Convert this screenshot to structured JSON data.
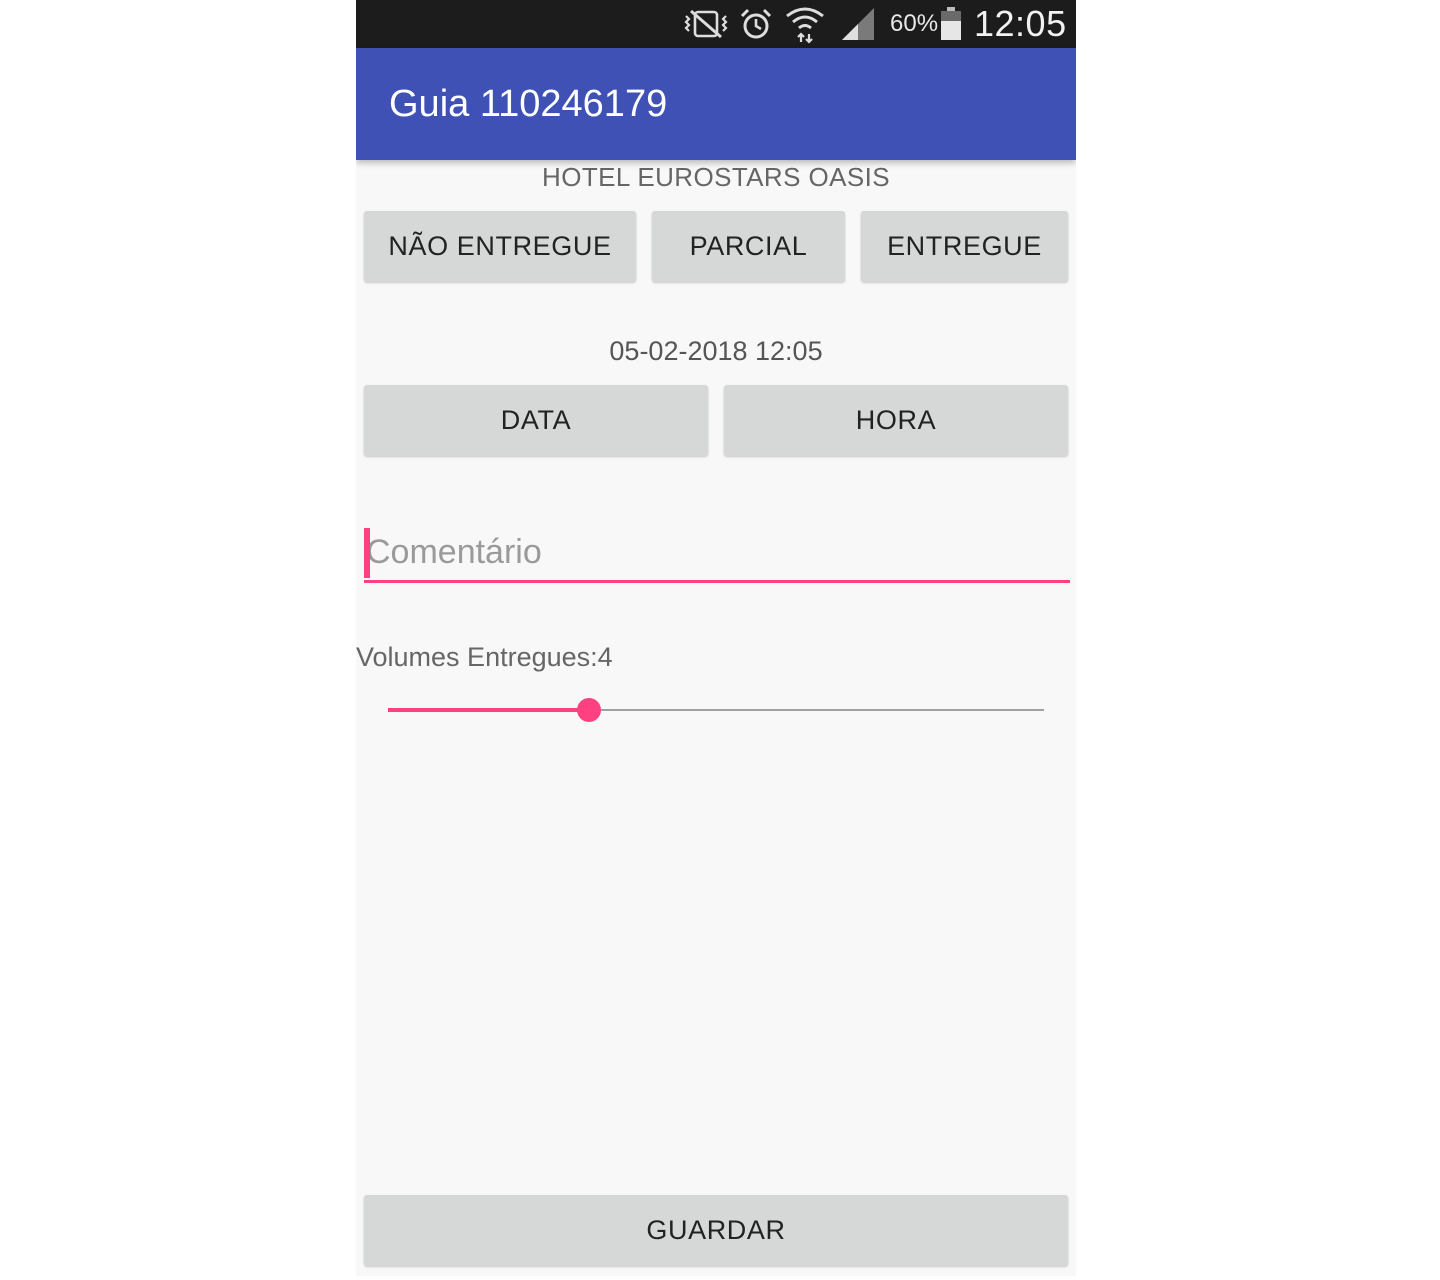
{
  "status_bar": {
    "battery": "60%",
    "time": "12:05",
    "icons": [
      "vibrate-icon",
      "alarm-icon",
      "wifi-icon",
      "signal-icon",
      "battery-icon"
    ]
  },
  "app_bar": {
    "title": "Guia 110246179"
  },
  "hotel": "HOTEL EUROSTARS OASIS",
  "status_buttons": {
    "not_delivered": "NÃO ENTREGUE",
    "partial": "PARCIAL",
    "delivered": "ENTREGUE"
  },
  "datetime": "05-02-2018 12:05",
  "datetime_buttons": {
    "date": "DATA",
    "time": "HORA"
  },
  "comment": {
    "placeholder": "Comentário",
    "value": ""
  },
  "volumes": {
    "label": "Volumes Entregues:4",
    "slider_fraction": 0.306
  },
  "save_button": "GUARDAR",
  "colors": {
    "primary": "#3f51b5",
    "accent": "#ff4081",
    "status_bar": "#1c1c1c",
    "button": "#d6d7d7",
    "background": "#f8f8f8"
  }
}
